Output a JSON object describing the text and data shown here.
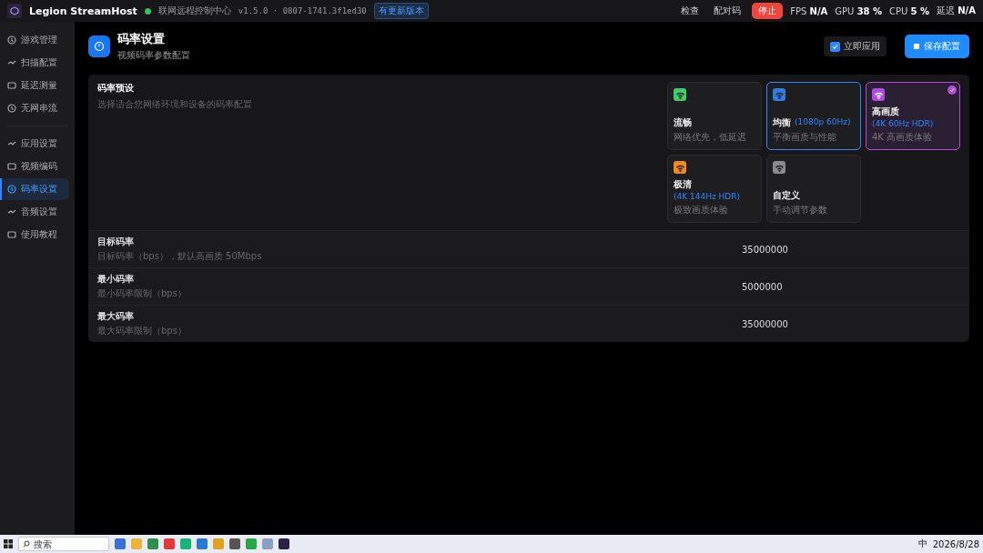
{
  "app": {
    "title": "Legion StreamHost",
    "online": true,
    "status": "联网远程控制中心",
    "version": "v1.5.0 · 0807-1741.3f1ed30",
    "update_badge": "有更新版本"
  },
  "top_actions": [
    {
      "label": "检查",
      "kind": "plain"
    },
    {
      "label": "配对码",
      "kind": "plain"
    },
    {
      "label": "停止",
      "kind": "danger"
    }
  ],
  "stats": [
    {
      "label": "FPS",
      "value": "N/A"
    },
    {
      "label": "GPU",
      "value": "38 %"
    },
    {
      "label": "CPU",
      "value": "5 %"
    },
    {
      "label": "延迟",
      "value": "N/A"
    }
  ],
  "sidebar": {
    "groups": [
      [
        {
          "label": "游戏管理",
          "selected": false
        },
        {
          "label": "扫描配置",
          "selected": false
        },
        {
          "label": "延迟测量",
          "selected": false
        },
        {
          "label": "无网串流",
          "selected": false
        }
      ],
      [
        {
          "label": "应用设置",
          "selected": false
        },
        {
          "label": "视频编码",
          "selected": false
        },
        {
          "label": "码率设置",
          "selected": true
        },
        {
          "label": "音频设置",
          "selected": false
        },
        {
          "label": "使用教程",
          "selected": false
        }
      ]
    ]
  },
  "header": {
    "title": "码率设置",
    "subtitle": "视频码率参数配置",
    "apply_now": {
      "label": "立即应用",
      "checked": true
    },
    "save_button": "保存配置"
  },
  "presets": {
    "title": "码率预设",
    "description": "选择适合您网络环境和设备的码率配置",
    "items": [
      {
        "name": "流畅",
        "desc": "网络优先，低延迟",
        "color": "#3ecf6a",
        "selected": false,
        "focused": false
      },
      {
        "name": "均衡",
        "tag": "(1080p 60Hz)",
        "desc": "平衡画质与性能",
        "color": "#2f7de0",
        "selected": false,
        "focused": true
      },
      {
        "name": "高画质",
        "tag": "(4K 60Hz HDR)",
        "desc": "4K 高画质体验",
        "color": "#b44be0",
        "selected": true,
        "focused": false
      },
      {
        "name": "极清",
        "tag": "(4K 144Hz HDR)",
        "desc": "极致画质体验",
        "color": "#f08a1c",
        "selected": false,
        "focused": false
      },
      {
        "name": "自定义",
        "desc": "手动调节参数",
        "color": "#8a8a90",
        "selected": false,
        "focused": false
      }
    ]
  },
  "settings": [
    {
      "label": "目标码率",
      "desc": "目标码率（bps），默认高画质 50Mbps",
      "value": "35000000"
    },
    {
      "label": "最小码率",
      "desc": "最小码率限制（bps）",
      "value": "5000000"
    },
    {
      "label": "最大码率",
      "desc": "最大码率限制（bps）",
      "value": "35000000"
    }
  ],
  "taskbar": {
    "search_placeholder": "搜索",
    "ime": "中",
    "date": "2026/8/28"
  }
}
